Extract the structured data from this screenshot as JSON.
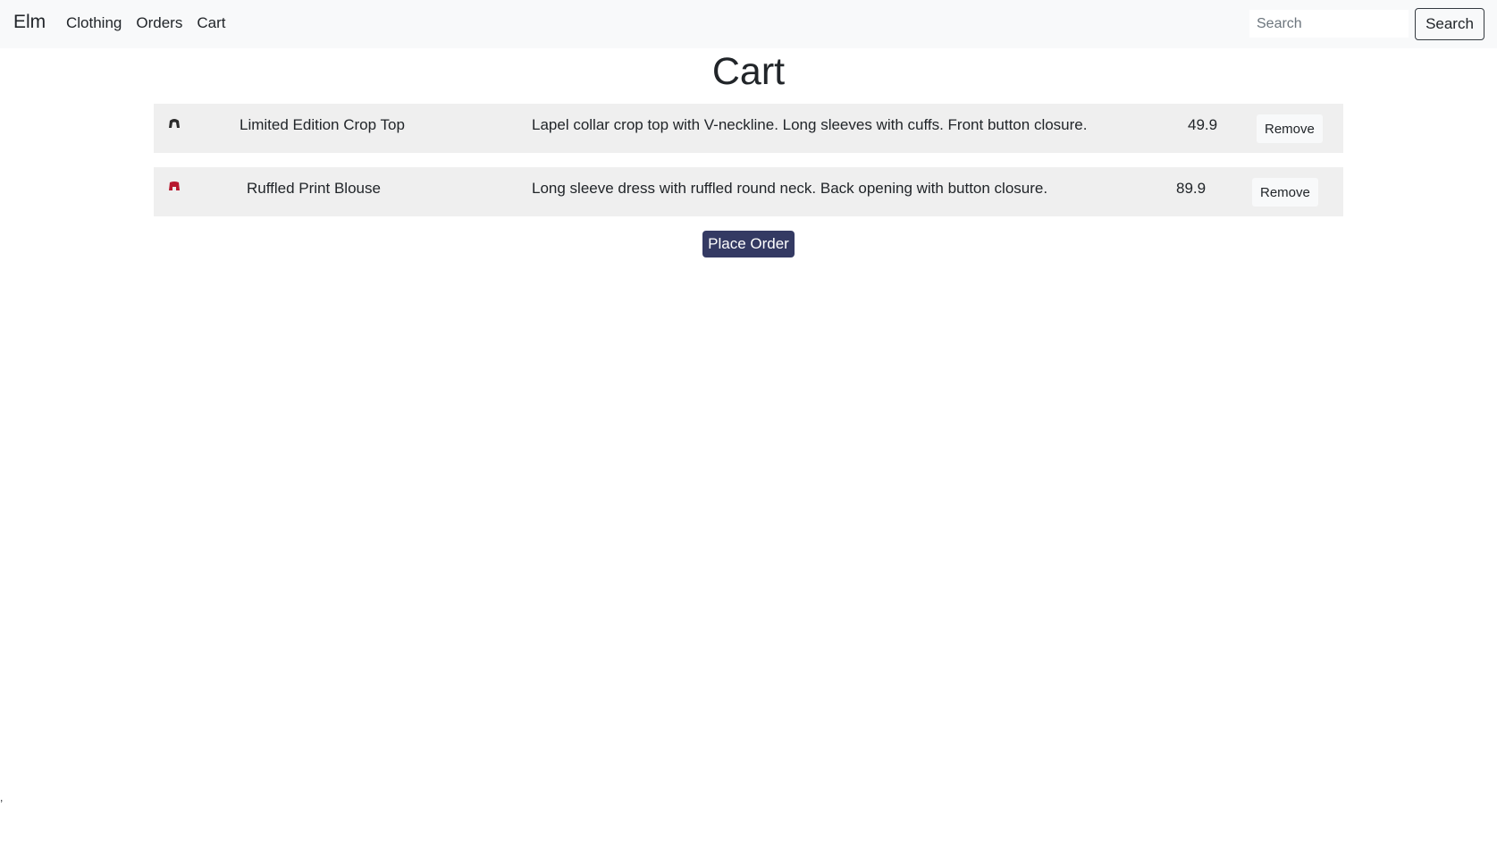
{
  "navbar": {
    "brand": "Elm",
    "links": [
      "Clothing",
      "Orders",
      "Cart"
    ],
    "search_placeholder": "Search",
    "search_button": "Search"
  },
  "page": {
    "title": "Cart"
  },
  "cart": {
    "items": [
      {
        "icon": "black-crop-top-thumbnail",
        "icon_color": "#2b2b2b",
        "name": "Limited Edition Crop Top",
        "description": "Lapel collar crop top with V-neckline. Long sleeves with cuffs. Front button closure.",
        "price": "49.9",
        "remove_label": "Remove"
      },
      {
        "icon": "red-blouse-thumbnail",
        "icon_color": "#b8192f",
        "name": "Ruffled Print Blouse",
        "description": "Long sleeve dress with ruffled round neck. Back opening with button closure.",
        "price": "89.9",
        "remove_label": "Remove"
      }
    ],
    "place_order_label": "Place Order"
  },
  "footer_mark": ","
}
